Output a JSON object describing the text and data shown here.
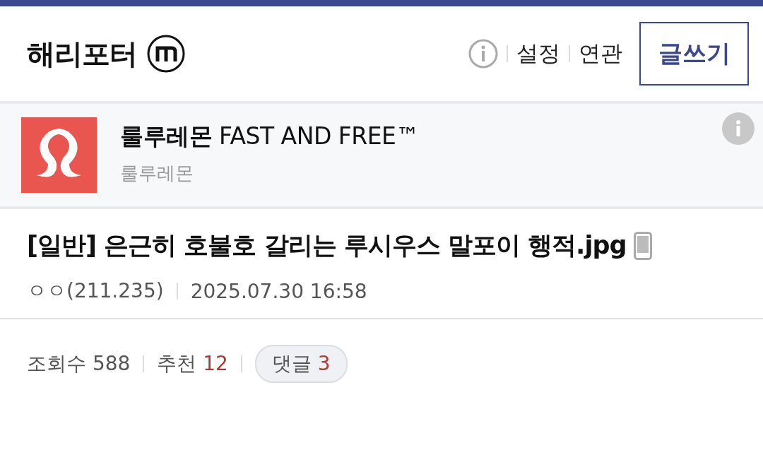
{
  "header": {
    "title": "해리포터",
    "links": [
      "설정",
      "연관"
    ],
    "write_button": "글쓰기"
  },
  "ad": {
    "title": "룰루레몬",
    "title_suffix": "FAST AND FREE™",
    "advertiser": "룰루레몬"
  },
  "post": {
    "title": "[일반] 은근히 호불호 갈리는 루시우스 말포이 행적.jpg",
    "author": "ㅇㅇ(211.235)",
    "date": "2025.07.30 16:58"
  },
  "stats": [
    {
      "kind": "plain",
      "label": "조회수",
      "value": "588"
    },
    {
      "kind": "plain",
      "label": "추천",
      "value": "12"
    },
    {
      "kind": "pill",
      "label": "댓글",
      "value": "3"
    }
  ]
}
